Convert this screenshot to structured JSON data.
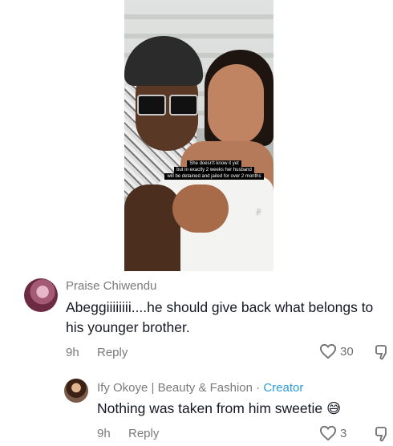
{
  "video": {
    "caption_lines": [
      "She doesn't know it yet",
      "but in exactly 2 weeks her husband",
      "will be detained and jailed for over 2 months"
    ],
    "tiktok_icon": "tiktok-logo-icon"
  },
  "comments": [
    {
      "author": "Praise Chiwendu",
      "text": "Abeggiiiiiiii....he should give back what belongs to his younger brother.",
      "time": "9h",
      "reply_label": "Reply",
      "likes": "30"
    },
    {
      "author": "Ify Okoye | Beauty & Fashion",
      "separator": " · ",
      "badge": "Creator",
      "text": "Nothing was taken from him sweetie 😅",
      "time": "9h",
      "reply_label": "Reply",
      "likes": "3"
    }
  ],
  "colors": {
    "creator_badge": "#2b9bd9",
    "muted_text": "#7a7a7a",
    "main_text": "#161823"
  }
}
